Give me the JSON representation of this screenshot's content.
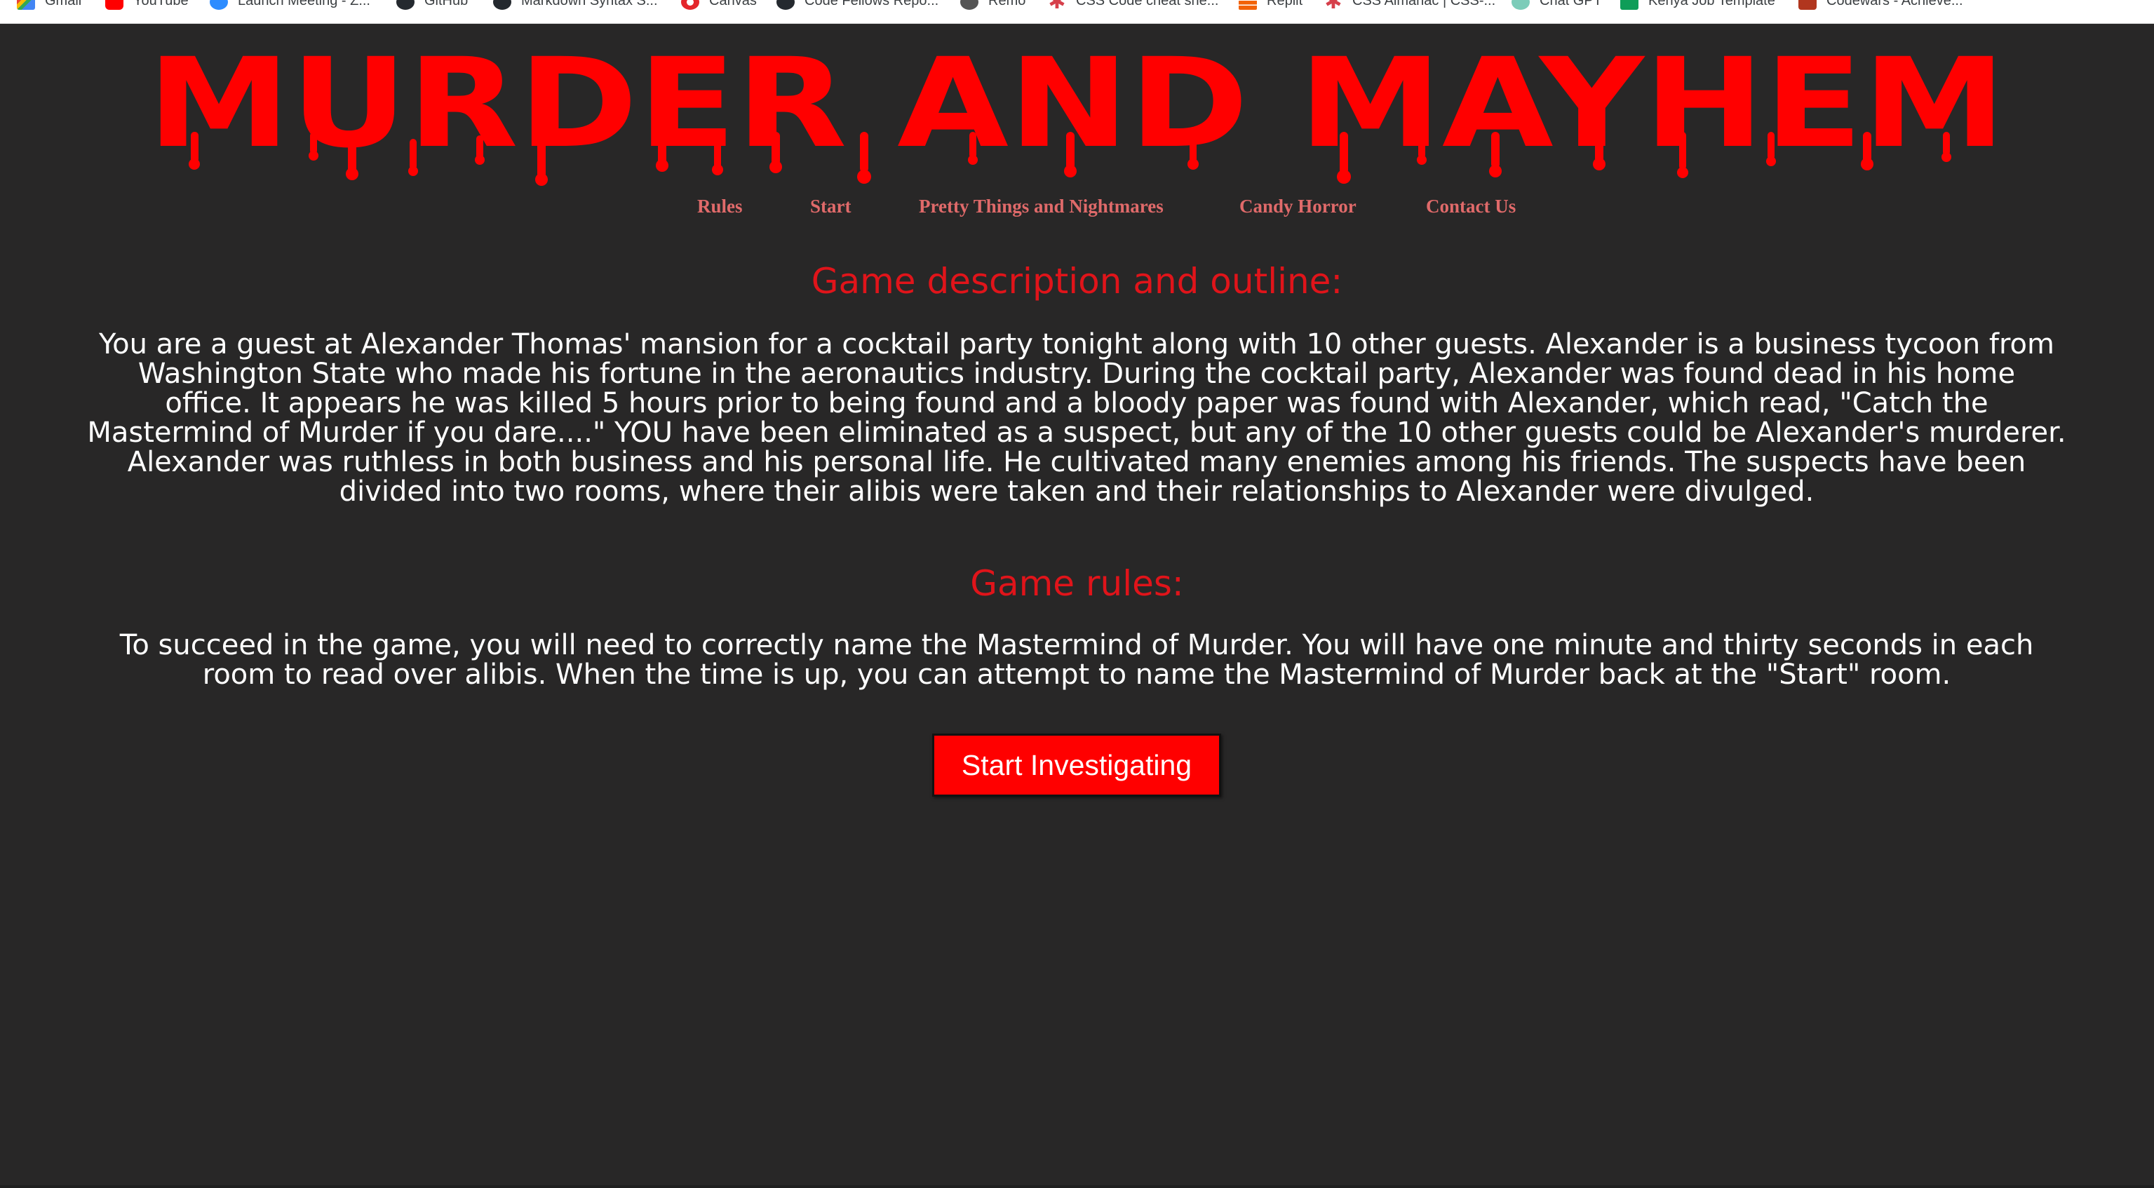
{
  "bookmarks": [
    {
      "label": "Gmail",
      "icon": "gmail-icon"
    },
    {
      "label": "YouTube",
      "icon": "youtube-icon"
    },
    {
      "label": "Launch Meeting - Z...",
      "icon": "zoom-icon"
    },
    {
      "label": "GitHub",
      "icon": "github-icon"
    },
    {
      "label": "Markdown Syntax S...",
      "icon": "github-icon"
    },
    {
      "label": "Canvas",
      "icon": "canvas-icon"
    },
    {
      "label": "Code Fellows Repo...",
      "icon": "github-icon"
    },
    {
      "label": "Remo",
      "icon": "remo-icon"
    },
    {
      "label": "CSS Code cheat she...",
      "icon": "asterisk-icon"
    },
    {
      "label": "Replit",
      "icon": "replit-icon"
    },
    {
      "label": "CSS Almanac | CSS-...",
      "icon": "asterisk-icon"
    },
    {
      "label": "Chat GPT",
      "icon": "chatgpt-icon"
    },
    {
      "label": "Kenya Job Template",
      "icon": "sheets-icon"
    },
    {
      "label": "Codewars - Achieve...",
      "icon": "codewars-icon"
    }
  ],
  "site": {
    "title": "MURDER AND MAYHEM",
    "title_color": "#ff0000"
  },
  "nav": {
    "items": [
      "Rules",
      "Start",
      "Pretty Things and Nightmares",
      "Candy Horror",
      "Contact Us"
    ],
    "color": "#e06a6a"
  },
  "description": {
    "heading": "Game description and outline:",
    "lines": [
      "You are a guest at Alexander Thomas' mansion for a cocktail party tonight along with 10 other guests. Alexander is a business tycoon from",
      "Washington State who made his fortune in the aeronautics industry. During the cocktail party, Alexander was found dead in his home",
      "office. It appears he was killed 5 hours prior to being found and a bloody paper was found with Alexander, which read, \"Catch the",
      "Mastermind of Murder if you dare....\" YOU have been eliminated as a suspect, but any of the 10 other guests could be Alexander's murderer.",
      "Alexander was ruthless in both business and his personal life. He cultivated many enemies among his friends. The suspects have been",
      "divided into two rooms, where their alibis were taken and their relationships to Alexander were divulged."
    ]
  },
  "rules": {
    "heading": "Game rules:",
    "lines": [
      "To succeed in the game, you will need to correctly name the Mastermind of Murder. You will have one minute and thirty seconds in each",
      "room to read over alibis. When the time is up, you can attempt to name the Mastermind of Murder back at the \"Start\" room."
    ]
  },
  "cta": {
    "label": "Start Investigating",
    "color": "#ff0000"
  },
  "colors": {
    "background": "#282727",
    "heading": "#e0141a",
    "body_text": "#ffffff"
  }
}
